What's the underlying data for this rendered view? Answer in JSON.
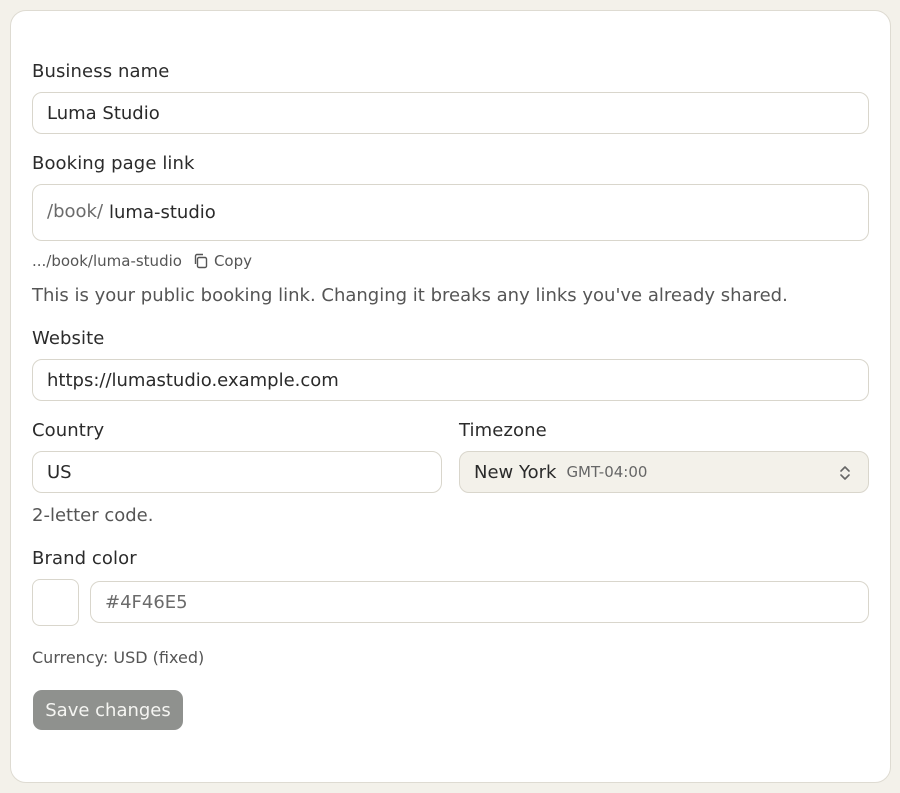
{
  "form": {
    "business_name": {
      "label": "Business name",
      "value": "Luma Studio"
    },
    "booking_link": {
      "label": "Booking page link",
      "prefix": "/book/",
      "value": "luma-studio",
      "preview": ".../book/luma-studio",
      "copy_label": "Copy",
      "help": "This is your public booking link. Changing it breaks any links you've already shared."
    },
    "website": {
      "label": "Website",
      "value": "https://lumastudio.example.com"
    },
    "country": {
      "label": "Country",
      "value": "US",
      "help": "2-letter code."
    },
    "timezone": {
      "label": "Timezone",
      "city": "New York",
      "offset": "GMT-04:00"
    },
    "brand_color": {
      "label": "Brand color",
      "placeholder": "#4F46E5"
    },
    "currency_note": "Currency: USD (fixed)",
    "save_label": "Save changes"
  },
  "colors": {
    "page_bg": "#f3f1ea",
    "card_bg": "#ffffff",
    "border": "#d9d6cc",
    "save_button_bg": "#8f918e"
  },
  "icons": {
    "copy": "copy-icon",
    "select": "chevron-up-down-icon"
  }
}
